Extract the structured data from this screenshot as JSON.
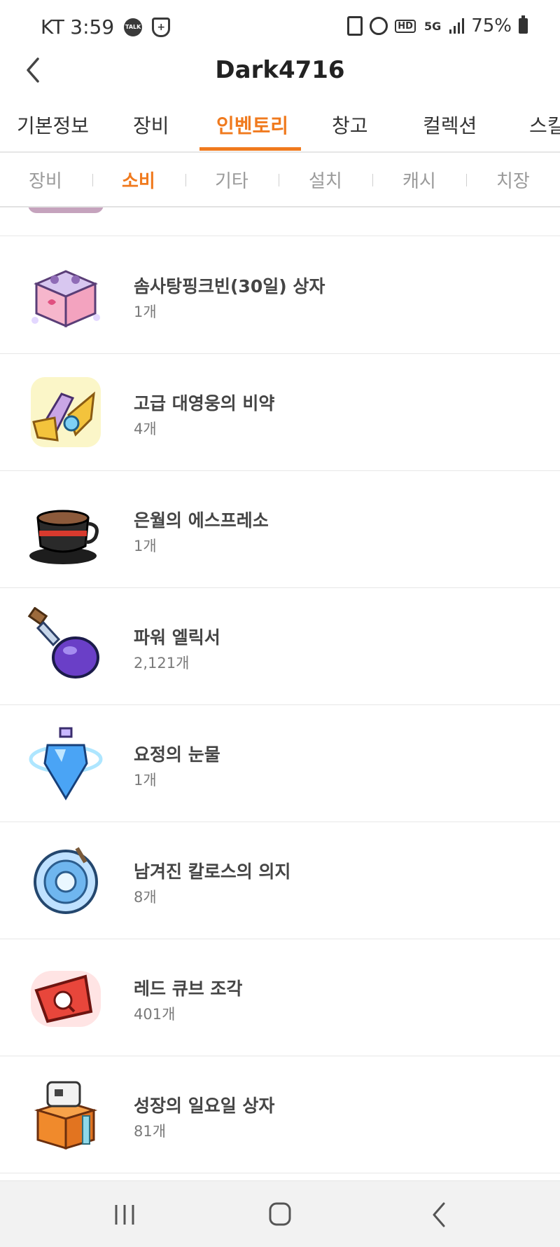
{
  "status_bar": {
    "carrier": "KT",
    "time": "3:59",
    "talk_icon": "TALK",
    "battery_percent": "75%",
    "network": "5G",
    "hd_label": "HD"
  },
  "header": {
    "title": "Dark4716"
  },
  "tabs": [
    {
      "label": "기본정보"
    },
    {
      "label": "장비"
    },
    {
      "label": "인벤토리"
    },
    {
      "label": "창고"
    },
    {
      "label": "컬렉션"
    },
    {
      "label": "스킬"
    }
  ],
  "subtabs": [
    {
      "label": "장비"
    },
    {
      "label": "소비"
    },
    {
      "label": "기타"
    },
    {
      "label": "설치"
    },
    {
      "label": "캐시"
    },
    {
      "label": "치장"
    }
  ],
  "items": [
    {
      "name": "솜사탕핑크빈(30일) 상자",
      "count": "1개",
      "icon": "pink-gift-box-icon"
    },
    {
      "name": "고급 대영웅의 비약",
      "count": "4개",
      "icon": "hero-elixir-icon"
    },
    {
      "name": "은월의 에스프레소",
      "count": "1개",
      "icon": "espresso-cup-icon"
    },
    {
      "name": "파워 엘릭서",
      "count": "2,121개",
      "icon": "power-elixir-bottle-icon"
    },
    {
      "name": "요정의 눈물",
      "count": "1개",
      "icon": "fairy-tear-potion-icon"
    },
    {
      "name": "남겨진 칼로스의 의지",
      "count": "8개",
      "icon": "kalos-will-orb-icon"
    },
    {
      "name": "레드 큐브 조각",
      "count": "401개",
      "icon": "red-cube-fragment-icon"
    },
    {
      "name": "성장의 일요일 상자",
      "count": "81개",
      "icon": "sunday-growth-box-icon"
    }
  ],
  "colors": {
    "accent": "#f07a1e",
    "text": "#454545",
    "muted": "#9a9a9a"
  }
}
